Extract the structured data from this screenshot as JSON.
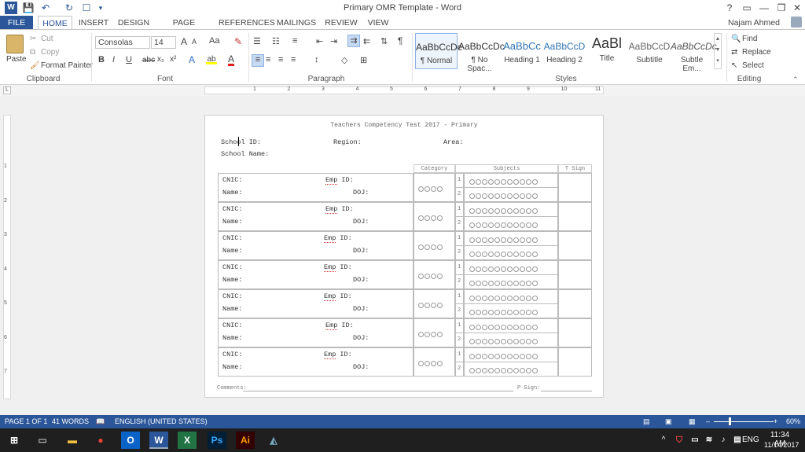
{
  "window": {
    "title": "Primary OMR Template - Word",
    "user": "Najam Ahmed",
    "help": "?",
    "qat_more": "▾"
  },
  "tabs": [
    {
      "label": "FILE"
    },
    {
      "label": "HOME"
    },
    {
      "label": "INSERT"
    },
    {
      "label": "DESIGN"
    },
    {
      "label": "PAGE LAYOUT"
    },
    {
      "label": "REFERENCES"
    },
    {
      "label": "MAILINGS"
    },
    {
      "label": "REVIEW"
    },
    {
      "label": "VIEW"
    }
  ],
  "clipboard": {
    "paste": "Paste",
    "cut": "Cut",
    "copy": "Copy",
    "format_painter": "Format Painter",
    "label": "Clipboard"
  },
  "font": {
    "name": "Consolas",
    "size": "14",
    "label": "Font",
    "grow": "A",
    "shrink": "A",
    "change_case": "Aa",
    "bold": "B",
    "italic": "I",
    "underline": "U",
    "strike": "abc",
    "sub": "x₂",
    "sup": "x²",
    "text_effects": "A",
    "font_color": "A"
  },
  "paragraph": {
    "label": "Paragraph",
    "pilcrow": "¶"
  },
  "styles": {
    "label": "Styles",
    "items": [
      {
        "preview": "AaBbCcDc",
        "name": "¶ Normal"
      },
      {
        "preview": "AaBbCcDc",
        "name": "¶ No Spac..."
      },
      {
        "preview": "AaBbCc",
        "name": "Heading 1"
      },
      {
        "preview": "AaBbCcD",
        "name": "Heading 2"
      },
      {
        "preview": "AaBl",
        "name": "Title"
      },
      {
        "preview": "AaBbCcD",
        "name": "Subtitle"
      },
      {
        "preview": "AaBbCcDc",
        "name": "Subtle Em..."
      }
    ]
  },
  "editing": {
    "label": "Editing",
    "find": "Find",
    "replace": "Replace",
    "select": "Select"
  },
  "ruler": {
    "ticks": [
      "1",
      "2",
      "3",
      "4",
      "5",
      "6",
      "7",
      "8",
      "9",
      "10",
      "11"
    ],
    "vticks": [
      "1",
      "2",
      "3",
      "4",
      "5",
      "6",
      "7"
    ]
  },
  "document": {
    "heading": "Teachers Competency Test 2017 - Primary",
    "school_id": "School ID:",
    "region": "Region:",
    "area": "Area:",
    "school_name": "School Name:",
    "col_category": "Category",
    "col_subjects": "Subjects",
    "col_tsign": "T Sign",
    "cnic": "CNIC:",
    "emp_prefix": "Emp",
    "emp_suffix": " ID:",
    "name": "Name:",
    "doj": "DOJ:",
    "row1": "1",
    "row2": "2",
    "comments": "Comments:",
    "psign": "P Sign:"
  },
  "status": {
    "page": "PAGE 1 OF 1",
    "words": "41 WORDS",
    "language": "ENGLISH (UNITED STATES)",
    "zoom": "60%"
  },
  "taskbar": {
    "time": "11:34 AM",
    "date": "11/14/2017",
    "lang": "ENG"
  }
}
